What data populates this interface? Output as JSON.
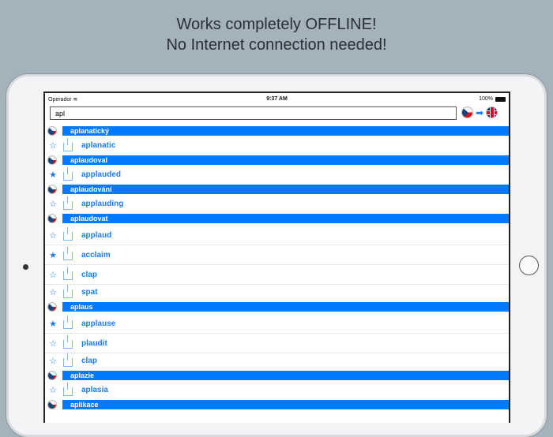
{
  "headline": [
    "Works completely OFFLINE!",
    "No Internet connection needed!"
  ],
  "status": {
    "carrier": "Operador",
    "time": "9:37 AM",
    "battery": "100%"
  },
  "search": {
    "value": "apl"
  },
  "colors": {
    "accent": "#007aff"
  },
  "rows": [
    {
      "type": "h",
      "text": "aplanatický"
    },
    {
      "type": "e",
      "text": "aplanatic",
      "fav": false
    },
    {
      "type": "h",
      "text": "aplaudoval"
    },
    {
      "type": "e",
      "text": "applauded",
      "fav": true
    },
    {
      "type": "h",
      "text": "aplaudování"
    },
    {
      "type": "e",
      "text": "applauding",
      "fav": false
    },
    {
      "type": "h",
      "text": "aplaudovat"
    },
    {
      "type": "e",
      "text": "applaud",
      "fav": false
    },
    {
      "type": "e",
      "text": "acclaim",
      "fav": true
    },
    {
      "type": "e",
      "text": "clap",
      "fav": false
    },
    {
      "type": "e",
      "text": "spat",
      "fav": false
    },
    {
      "type": "h",
      "text": "aplaus"
    },
    {
      "type": "e",
      "text": "applause",
      "fav": true
    },
    {
      "type": "e",
      "text": "plaudit",
      "fav": false
    },
    {
      "type": "e",
      "text": "clap",
      "fav": false
    },
    {
      "type": "h",
      "text": "aplazie"
    },
    {
      "type": "e",
      "text": "aplasia",
      "fav": false
    },
    {
      "type": "h",
      "text": "aplikace"
    }
  ]
}
